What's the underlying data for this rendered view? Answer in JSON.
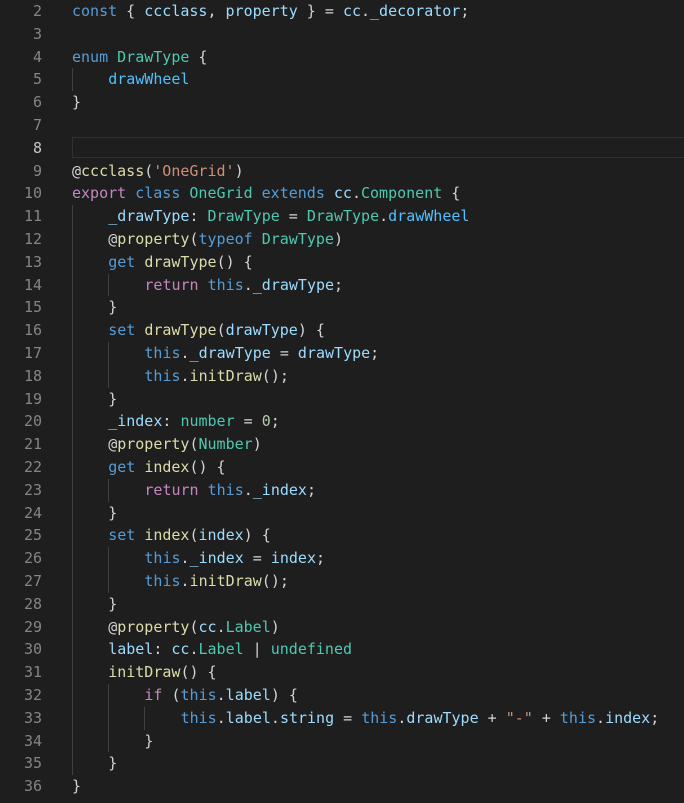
{
  "editor": {
    "lines": [
      {
        "n": "2",
        "tokens": [
          [
            "kw",
            "const"
          ],
          [
            "pl",
            " { "
          ],
          [
            "var",
            "ccclass"
          ],
          [
            "pl",
            ", "
          ],
          [
            "var",
            "property"
          ],
          [
            "pl",
            " } = "
          ],
          [
            "var",
            "cc"
          ],
          [
            "pl",
            "."
          ],
          [
            "var",
            "_decorator"
          ],
          [
            "pl",
            ";"
          ]
        ]
      },
      {
        "n": "3",
        "tokens": []
      },
      {
        "n": "4",
        "tokens": [
          [
            "kw",
            "enum"
          ],
          [
            "pl",
            " "
          ],
          [
            "type",
            "DrawType"
          ],
          [
            "pl",
            " {"
          ]
        ]
      },
      {
        "n": "5",
        "indent": 1,
        "tokens": [
          [
            "enm",
            "drawWheel"
          ]
        ]
      },
      {
        "n": "6",
        "tokens": [
          [
            "pl",
            "}"
          ]
        ]
      },
      {
        "n": "7",
        "tokens": []
      },
      {
        "n": "8",
        "current": true,
        "tokens": []
      },
      {
        "n": "9",
        "tokens": [
          [
            "pl",
            "@"
          ],
          [
            "fn",
            "ccclass"
          ],
          [
            "pl",
            "("
          ],
          [
            "str",
            "'OneGrid'"
          ],
          [
            "pl",
            ")"
          ]
        ]
      },
      {
        "n": "10",
        "tokens": [
          [
            "ctl",
            "export"
          ],
          [
            "pl",
            " "
          ],
          [
            "kw",
            "class"
          ],
          [
            "pl",
            " "
          ],
          [
            "type",
            "OneGrid"
          ],
          [
            "pl",
            " "
          ],
          [
            "kw",
            "extends"
          ],
          [
            "pl",
            " "
          ],
          [
            "var",
            "cc"
          ],
          [
            "pl",
            "."
          ],
          [
            "type",
            "Component"
          ],
          [
            "pl",
            " {"
          ]
        ]
      },
      {
        "n": "11",
        "indent": 1,
        "tokens": [
          [
            "prop",
            "_drawType"
          ],
          [
            "pl",
            ": "
          ],
          [
            "type",
            "DrawType"
          ],
          [
            "pl",
            " = "
          ],
          [
            "type",
            "DrawType"
          ],
          [
            "pl",
            "."
          ],
          [
            "enm",
            "drawWheel"
          ]
        ]
      },
      {
        "n": "12",
        "indent": 1,
        "tokens": [
          [
            "pl",
            "@"
          ],
          [
            "fn",
            "property"
          ],
          [
            "pl",
            "("
          ],
          [
            "kw",
            "typeof"
          ],
          [
            "pl",
            " "
          ],
          [
            "type",
            "DrawType"
          ],
          [
            "pl",
            ")"
          ]
        ]
      },
      {
        "n": "13",
        "indent": 1,
        "tokens": [
          [
            "kw",
            "get"
          ],
          [
            "pl",
            " "
          ],
          [
            "fn",
            "drawType"
          ],
          [
            "pl",
            "() {"
          ]
        ]
      },
      {
        "n": "14",
        "indent": 2,
        "tokens": [
          [
            "ctl",
            "return"
          ],
          [
            "pl",
            " "
          ],
          [
            "kw",
            "this"
          ],
          [
            "pl",
            "."
          ],
          [
            "prop",
            "_drawType"
          ],
          [
            "pl",
            ";"
          ]
        ]
      },
      {
        "n": "15",
        "indent": 1,
        "tokens": [
          [
            "pl",
            "}"
          ]
        ]
      },
      {
        "n": "16",
        "indent": 1,
        "tokens": [
          [
            "kw",
            "set"
          ],
          [
            "pl",
            " "
          ],
          [
            "fn",
            "drawType"
          ],
          [
            "pl",
            "("
          ],
          [
            "var",
            "drawType"
          ],
          [
            "pl",
            ") {"
          ]
        ]
      },
      {
        "n": "17",
        "indent": 2,
        "tokens": [
          [
            "kw",
            "this"
          ],
          [
            "pl",
            "."
          ],
          [
            "prop",
            "_drawType"
          ],
          [
            "pl",
            " = "
          ],
          [
            "var",
            "drawType"
          ],
          [
            "pl",
            ";"
          ]
        ]
      },
      {
        "n": "18",
        "indent": 2,
        "tokens": [
          [
            "kw",
            "this"
          ],
          [
            "pl",
            "."
          ],
          [
            "fn",
            "initDraw"
          ],
          [
            "pl",
            "();"
          ]
        ]
      },
      {
        "n": "19",
        "indent": 1,
        "tokens": [
          [
            "pl",
            "}"
          ]
        ]
      },
      {
        "n": "20",
        "indent": 1,
        "tokens": [
          [
            "prop",
            "_index"
          ],
          [
            "pl",
            ": "
          ],
          [
            "type",
            "number"
          ],
          [
            "pl",
            " = "
          ],
          [
            "num",
            "0"
          ],
          [
            "pl",
            ";"
          ]
        ]
      },
      {
        "n": "21",
        "indent": 1,
        "tokens": [
          [
            "pl",
            "@"
          ],
          [
            "fn",
            "property"
          ],
          [
            "pl",
            "("
          ],
          [
            "type",
            "Number"
          ],
          [
            "pl",
            ")"
          ]
        ]
      },
      {
        "n": "22",
        "indent": 1,
        "tokens": [
          [
            "kw",
            "get"
          ],
          [
            "pl",
            " "
          ],
          [
            "fn",
            "index"
          ],
          [
            "pl",
            "() {"
          ]
        ]
      },
      {
        "n": "23",
        "indent": 2,
        "tokens": [
          [
            "ctl",
            "return"
          ],
          [
            "pl",
            " "
          ],
          [
            "kw",
            "this"
          ],
          [
            "pl",
            "."
          ],
          [
            "prop",
            "_index"
          ],
          [
            "pl",
            ";"
          ]
        ]
      },
      {
        "n": "24",
        "indent": 1,
        "tokens": [
          [
            "pl",
            "}"
          ]
        ]
      },
      {
        "n": "25",
        "indent": 1,
        "tokens": [
          [
            "kw",
            "set"
          ],
          [
            "pl",
            " "
          ],
          [
            "fn",
            "index"
          ],
          [
            "pl",
            "("
          ],
          [
            "var",
            "index"
          ],
          [
            "pl",
            ") {"
          ]
        ]
      },
      {
        "n": "26",
        "indent": 2,
        "tokens": [
          [
            "kw",
            "this"
          ],
          [
            "pl",
            "."
          ],
          [
            "prop",
            "_index"
          ],
          [
            "pl",
            " = "
          ],
          [
            "var",
            "index"
          ],
          [
            "pl",
            ";"
          ]
        ]
      },
      {
        "n": "27",
        "indent": 2,
        "tokens": [
          [
            "kw",
            "this"
          ],
          [
            "pl",
            "."
          ],
          [
            "fn",
            "initDraw"
          ],
          [
            "pl",
            "();"
          ]
        ]
      },
      {
        "n": "28",
        "indent": 1,
        "tokens": [
          [
            "pl",
            "}"
          ]
        ]
      },
      {
        "n": "29",
        "indent": 1,
        "tokens": [
          [
            "pl",
            "@"
          ],
          [
            "fn",
            "property"
          ],
          [
            "pl",
            "("
          ],
          [
            "var",
            "cc"
          ],
          [
            "pl",
            "."
          ],
          [
            "type",
            "Label"
          ],
          [
            "pl",
            ")"
          ]
        ]
      },
      {
        "n": "30",
        "indent": 1,
        "tokens": [
          [
            "prop",
            "label"
          ],
          [
            "pl",
            ": "
          ],
          [
            "var",
            "cc"
          ],
          [
            "pl",
            "."
          ],
          [
            "type",
            "Label"
          ],
          [
            "pl",
            " | "
          ],
          [
            "type",
            "undefined"
          ]
        ]
      },
      {
        "n": "31",
        "indent": 1,
        "tokens": [
          [
            "fn",
            "initDraw"
          ],
          [
            "pl",
            "() {"
          ]
        ]
      },
      {
        "n": "32",
        "indent": 2,
        "tokens": [
          [
            "ctl",
            "if"
          ],
          [
            "pl",
            " ("
          ],
          [
            "kw",
            "this"
          ],
          [
            "pl",
            "."
          ],
          [
            "prop",
            "label"
          ],
          [
            "pl",
            ") {"
          ]
        ]
      },
      {
        "n": "33",
        "indent": 3,
        "tokens": [
          [
            "kw",
            "this"
          ],
          [
            "pl",
            "."
          ],
          [
            "prop",
            "label"
          ],
          [
            "pl",
            "."
          ],
          [
            "prop",
            "string"
          ],
          [
            "pl",
            " = "
          ],
          [
            "kw",
            "this"
          ],
          [
            "pl",
            "."
          ],
          [
            "prop",
            "drawType"
          ],
          [
            "pl",
            " + "
          ],
          [
            "str",
            "\"-\""
          ],
          [
            "pl",
            " + "
          ],
          [
            "kw",
            "this"
          ],
          [
            "pl",
            "."
          ],
          [
            "prop",
            "index"
          ],
          [
            "pl",
            ";"
          ]
        ]
      },
      {
        "n": "34",
        "indent": 2,
        "tokens": [
          [
            "pl",
            "}"
          ]
        ]
      },
      {
        "n": "35",
        "indent": 1,
        "tokens": [
          [
            "pl",
            "}"
          ]
        ]
      },
      {
        "n": "36",
        "tokens": [
          [
            "pl",
            "}"
          ]
        ]
      }
    ]
  }
}
